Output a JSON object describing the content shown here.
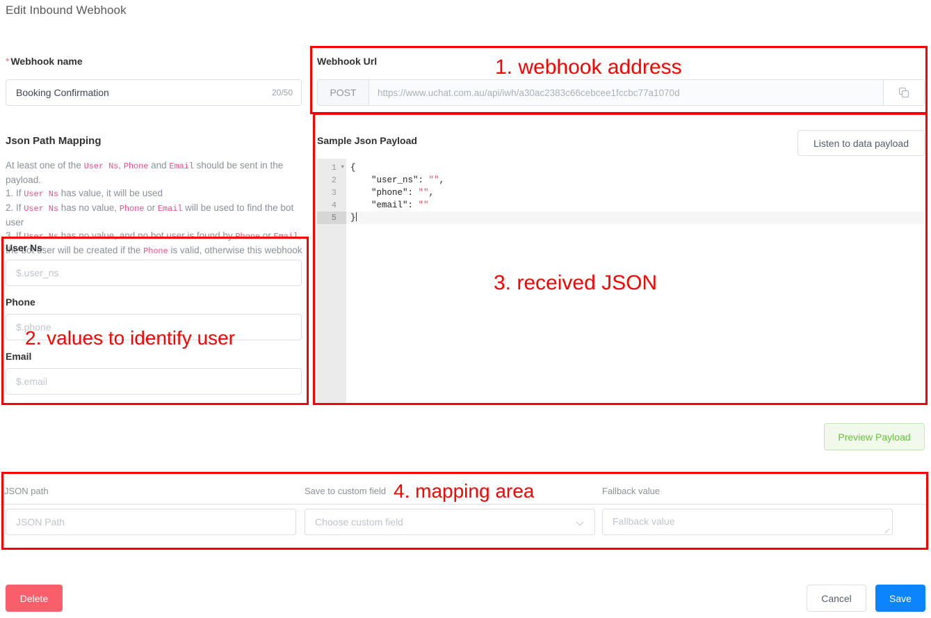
{
  "page": {
    "title": "Edit Inbound Webhook"
  },
  "webhook_name": {
    "label": "Webhook name",
    "required_marker": "*",
    "value": "Booking Confirmation",
    "counter": "20/50"
  },
  "json_path_mapping": {
    "title": "Json Path Mapping",
    "description_lines": [
      "At least one of the User Ns, Phone and Email should be sent in the payload.",
      "1. If User Ns has value, it will be used",
      "2. If User Ns has no value, Phone or Email will be used to find the bot user",
      "3. If User Ns has no value, and no bot user is found by Phone or Email, the bot user will be created if the Phone is valid, otherwise this webhook will not be processed."
    ],
    "fields": [
      {
        "label": "User Ns",
        "placeholder": "$.user_ns",
        "value": ""
      },
      {
        "label": "Phone",
        "placeholder": "$.phone",
        "value": ""
      },
      {
        "label": "Email",
        "placeholder": "$.email",
        "value": ""
      }
    ]
  },
  "webhook_url": {
    "label": "Webhook Url",
    "method": "POST",
    "url": "https://www.uchat.com.au/api/iwh/a30ac2383c66cebcee1fccbc77a1070d",
    "copy_icon": "copy-icon"
  },
  "sample_payload": {
    "label": "Sample Json Payload",
    "listen_button": "Listen to data payload",
    "lines": [
      {
        "n": "1",
        "foldable": true,
        "text": "{"
      },
      {
        "n": "2",
        "foldable": false,
        "text": "    \"user_ns\": \"\","
      },
      {
        "n": "3",
        "foldable": false,
        "text": "    \"phone\": \"\","
      },
      {
        "n": "4",
        "foldable": false,
        "text": "    \"email\": \"\""
      },
      {
        "n": "5",
        "foldable": false,
        "text": "}"
      }
    ]
  },
  "preview": {
    "button_label": "Preview Payload",
    "bg": "#f0f9eb",
    "fg": "#67c23a",
    "border": "#c2e7b0"
  },
  "mapping": {
    "columns": [
      "JSON path",
      "Save to custom field",
      "Fallback value"
    ],
    "rows": [
      {
        "json_path_placeholder": "JSON Path",
        "json_path_value": "",
        "custom_field_placeholder": "Choose custom field",
        "custom_field_value": "",
        "fallback_placeholder": "Fallback value",
        "fallback_value": ""
      }
    ]
  },
  "footer": {
    "delete": "Delete",
    "cancel": "Cancel",
    "save": "Save",
    "delete_color": "#f95e6b",
    "save_color": "#0c84fe"
  },
  "annotations": {
    "color": "#ff0000",
    "items": [
      {
        "id": "1",
        "text": "1. webhook address"
      },
      {
        "id": "2",
        "text": "2. values to identify user"
      },
      {
        "id": "3",
        "text": "3. received JSON"
      },
      {
        "id": "4",
        "text": "4. mapping area"
      }
    ]
  }
}
